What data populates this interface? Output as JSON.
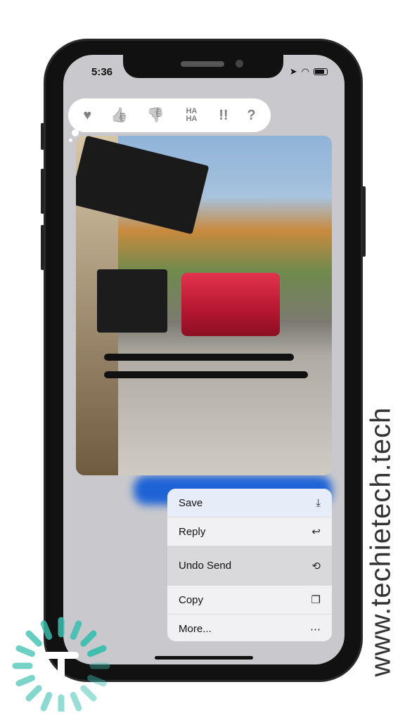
{
  "status_bar": {
    "time": "5:36"
  },
  "reactions": [
    {
      "icon": "heart-icon",
      "glyph": "♥"
    },
    {
      "icon": "thumbs-up-icon",
      "glyph": "👍"
    },
    {
      "icon": "thumbs-down-icon",
      "glyph": "👎"
    },
    {
      "icon": "haha-icon",
      "glyph": "HA HA"
    },
    {
      "icon": "exclamation-icon",
      "glyph": "!!"
    },
    {
      "icon": "question-icon",
      "glyph": "?"
    }
  ],
  "menu": {
    "items": [
      {
        "label": "Save",
        "icon": "save-icon",
        "glyph": "⤓"
      },
      {
        "label": "Reply",
        "icon": "reply-icon",
        "glyph": "↩"
      },
      {
        "label": "Undo Send",
        "icon": "undo-send-icon",
        "glyph": "⟲"
      },
      {
        "label": "Copy",
        "icon": "copy-icon",
        "glyph": "❐"
      },
      {
        "label": "More...",
        "icon": "more-icon",
        "glyph": "⋯"
      }
    ]
  },
  "watermark": "www.techietech.tech",
  "colors": {
    "accent": "#1e63d6",
    "logo": "#3bbfb0"
  }
}
